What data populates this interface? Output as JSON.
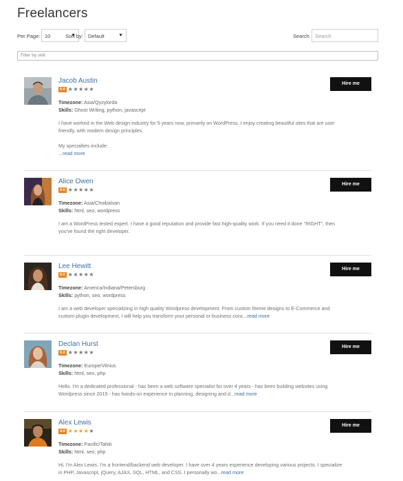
{
  "page": {
    "title": "Freelancers"
  },
  "toolbar": {
    "per_page_label": "Per Page:",
    "per_page_value": "10",
    "sort_label": "Sort by:",
    "sort_value": "Default",
    "search_label": "Search",
    "search_placeholder": "Search"
  },
  "filter": {
    "placeholder": "Filter by skill"
  },
  "labels": {
    "timezone": "Timezone:",
    "skills": "Skills:",
    "hire": "Hire me"
  },
  "colors": {
    "name_link": "#3e6f9e",
    "badge_zero": "#e8841f",
    "badge_four": "#e8841f",
    "star_filled": "#f0a31b",
    "star_empty": "#777777",
    "hire_button": "#111111"
  },
  "freelancers": [
    {
      "name": "Jacob Austin",
      "rating": "0.0",
      "stars_filled": 0,
      "timezone": "Asia/Qyzylorda",
      "skills": "Ghost Writing, python, javascript",
      "bio_line1": "I have worked in the Web design industry for 5 years now, primarily on WordPress. I enjoy creating beautiful sites that are user",
      "bio_line2": "friendly, with modern design principles.",
      "bio_line3": "My specialties include:",
      "more": "...read more"
    },
    {
      "name": "Alice Owen",
      "rating": "0.0",
      "stars_filled": 0,
      "timezone": "Asia/Choibalsan",
      "skills": "html, seo, wordpress",
      "bio_line1": "I am a WordPress tested expert. I have a good reputation and provide fast high-quality work. If you need it done \"RIGHT\", then",
      "bio_line2": "you've found the right developer."
    },
    {
      "name": "Lee Hewitt",
      "rating": "0.0",
      "stars_filled": 0,
      "timezone": "America/Indiana/Petersburg",
      "skills": "python, seo, wordpress",
      "bio_line1": "I am a web developer specializing in high quality Wordpress development. From custom theme designs to E-Commerce and",
      "bio_line2": "custom plugin development, I will help you transform your personal or business conc...",
      "more": "read more"
    },
    {
      "name": "Declan Hurst",
      "rating": "0.0",
      "stars_filled": 0,
      "timezone": "Europe/Vilnius",
      "skills": "html, seo, php",
      "bio_line1": "Hello. I'm a dedicated professional - has been a web software specialist for over 4 years - has been building websites using",
      "bio_line2": "Wordpress since 2015 - has hands-on experience in planning, designing and d...",
      "more": "read more"
    },
    {
      "name": "Alex Lewis",
      "rating": "4.0",
      "stars_filled": 4,
      "timezone": "Pacific/Tahiti",
      "skills": "html, seo, php",
      "bio_line1": "Hi, I'm Alex Lewis. I'm a frontend/backend web developer. I have over 4 years experience developing various projects. I specialize",
      "bio_line2": "in PHP, Javascript, jQuery, AJAX, SQL, HTML, and CSS. I personally wo...",
      "more": "read more"
    }
  ]
}
